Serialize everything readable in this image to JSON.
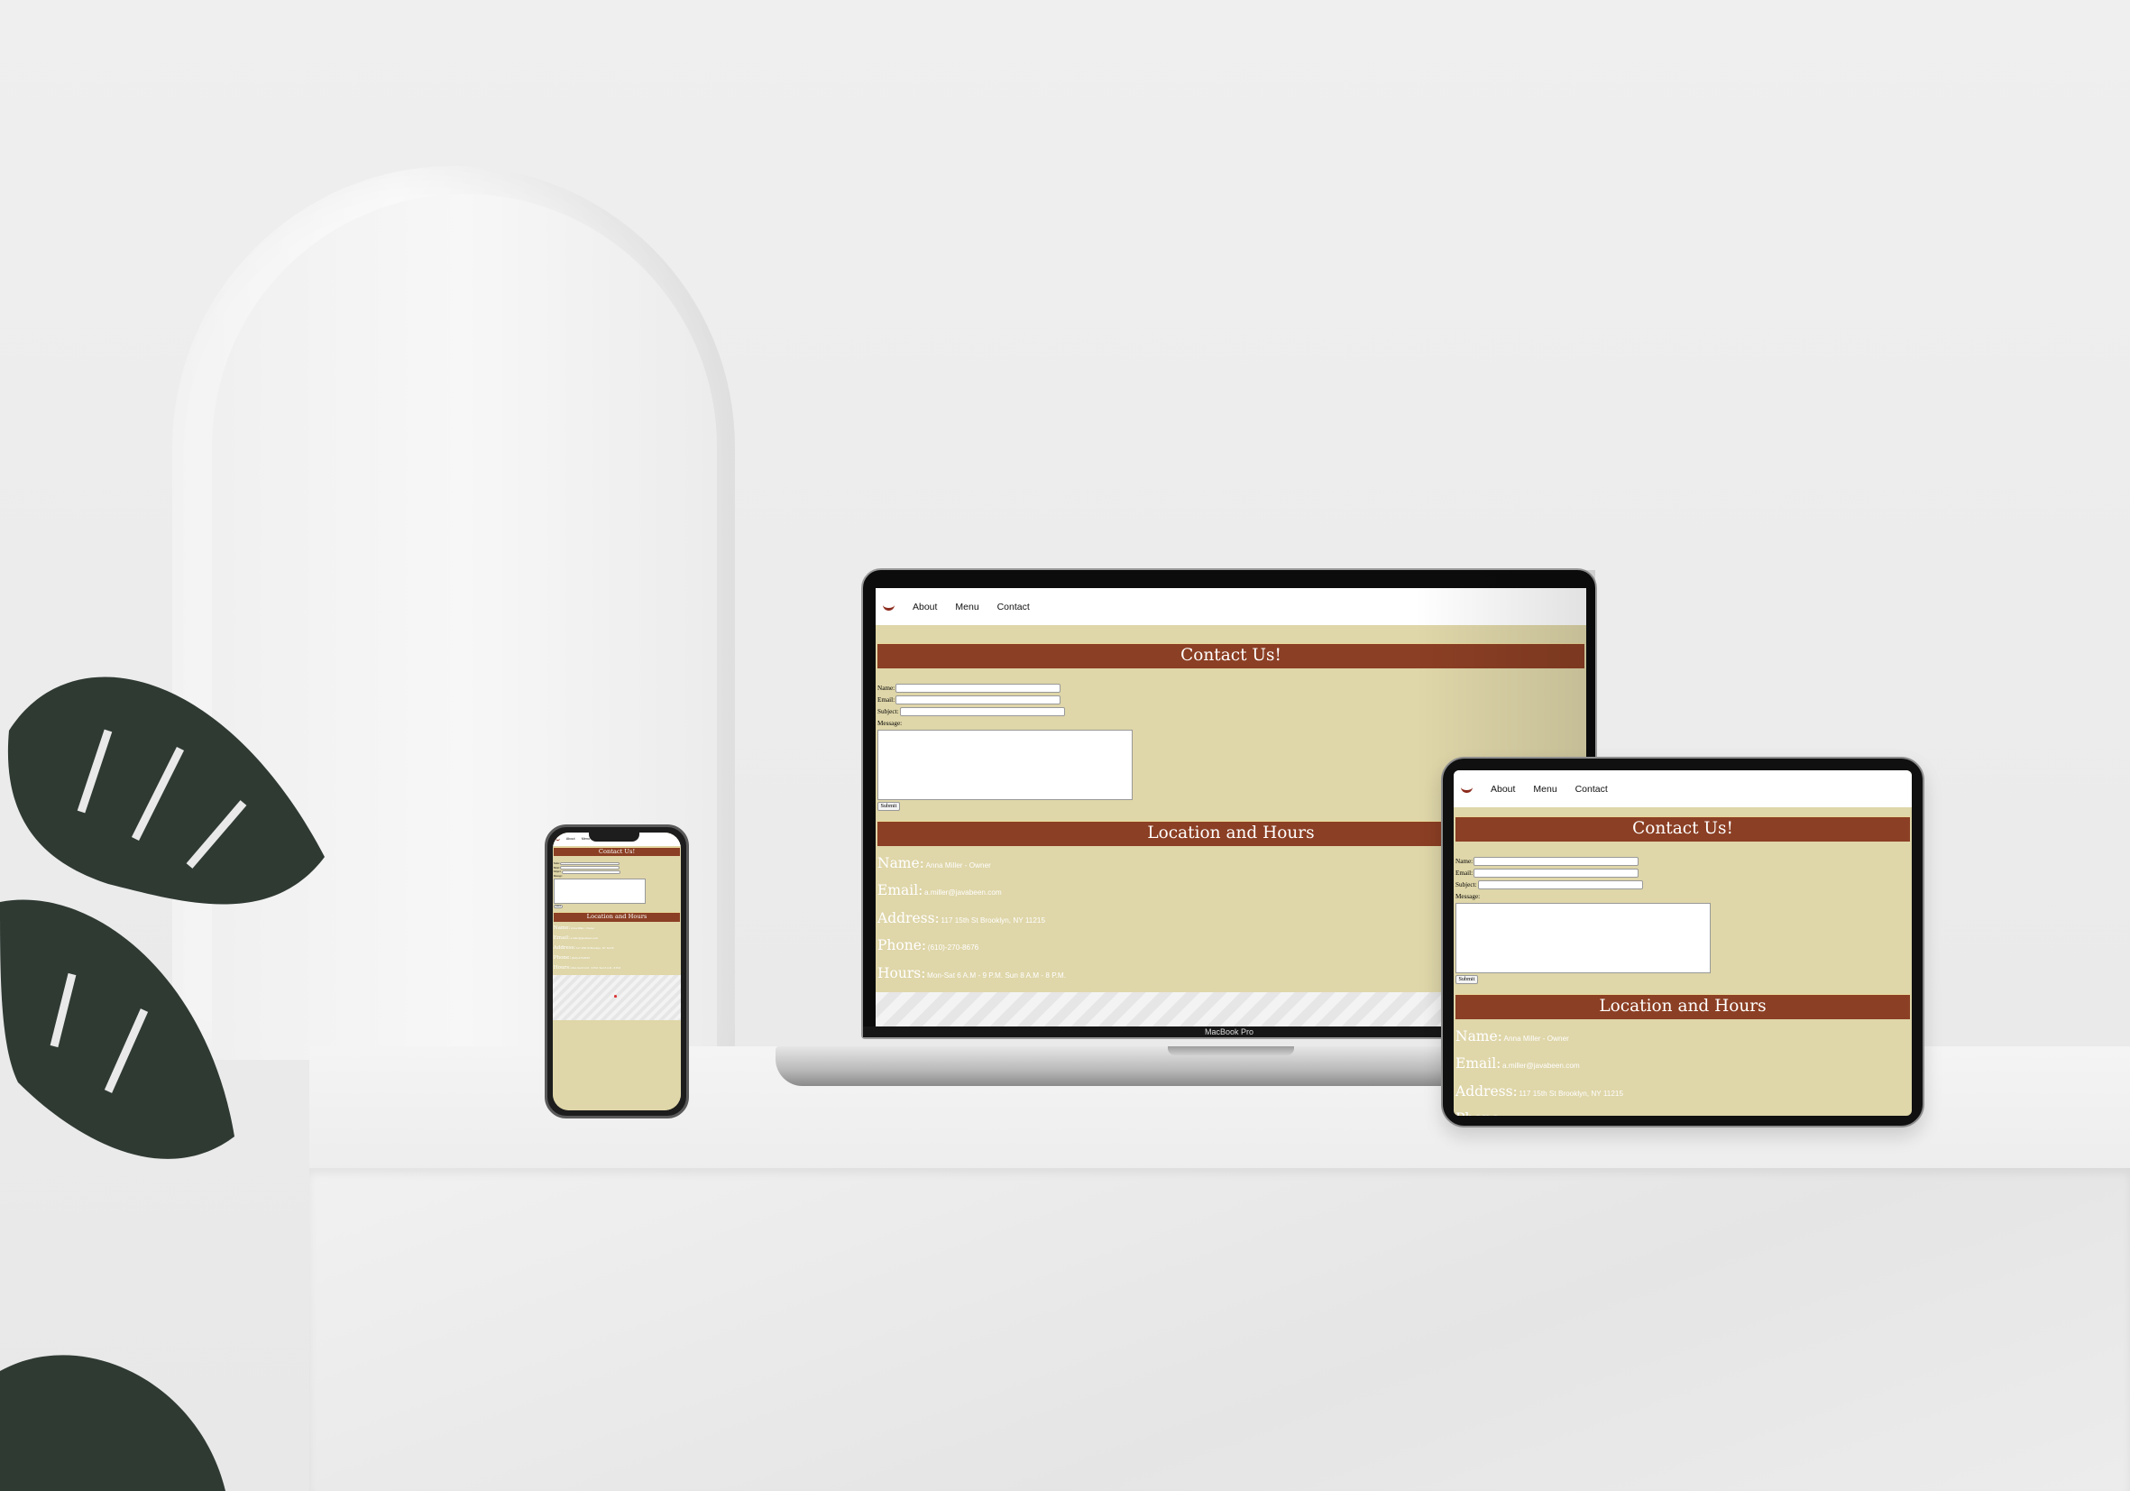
{
  "site": {
    "nav": [
      "About",
      "Menu",
      "Contact"
    ],
    "contact_title": "Contact Us!",
    "form": {
      "name": "Name:",
      "email": "Email:",
      "subject": "Subject:",
      "message": "Message:",
      "submit": "Submit"
    },
    "location_title": "Location and Hours",
    "info": [
      {
        "label": "Name:",
        "value": "Anna Miller - Owner"
      },
      {
        "label": "Email:",
        "value": "a.miller@javabeen.com"
      },
      {
        "label": "Address:",
        "value": "117 15th St Brooklyn, NY 11215"
      },
      {
        "label": "Phone:",
        "value": "(610)-270-8676"
      },
      {
        "label": "Hours:",
        "value": "Mon-Sat 6 A.M - 9 P.M. Sun 8 A.M - 8 P.M."
      }
    ]
  },
  "laptop": {
    "brand": "MacBook Pro"
  },
  "colors": {
    "header_bar": "#8b3f24",
    "page_bg": "#dfd6a9",
    "nav_bg": "#ffffff"
  }
}
